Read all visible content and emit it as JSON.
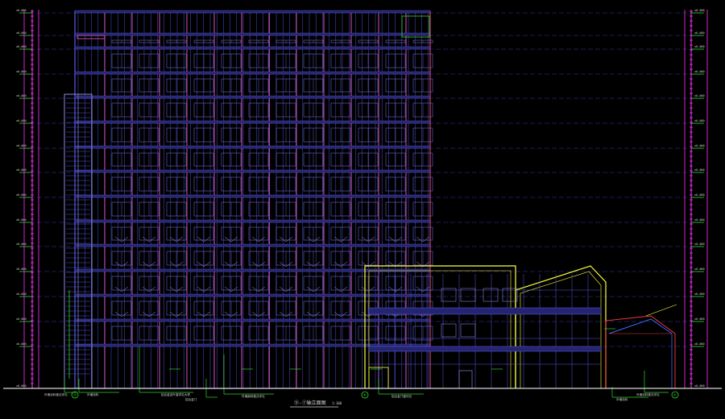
{
  "colors": {
    "background": "#000000",
    "facade_grid": "#5a5ae6",
    "column": "#e05acb",
    "magenta": "#ff33ff",
    "annex_outline": "#ffff3c",
    "green": "#2bd62b",
    "ground": "#d8d8d8",
    "blue": "#3a6cff",
    "red": "#ff3a3a",
    "cyan": "#38c8ff"
  },
  "drawing": {
    "title": "⑪-⑦轴立面图",
    "scale": "1:100"
  },
  "levels": {
    "count": 16,
    "label_pattern": "±0.000"
  },
  "annotations": [
    "外墙涂料做法详见",
    "外墙涂料",
    "铝合金百叶窗详见大样",
    "外墙面砖做法详见",
    "铝合金门窗详见",
    "外墙涂料做法详见",
    "外墙涂料",
    "铝合金门"
  ],
  "grid_bubbles": [
    "⑪",
    "⑨",
    "⑦"
  ]
}
